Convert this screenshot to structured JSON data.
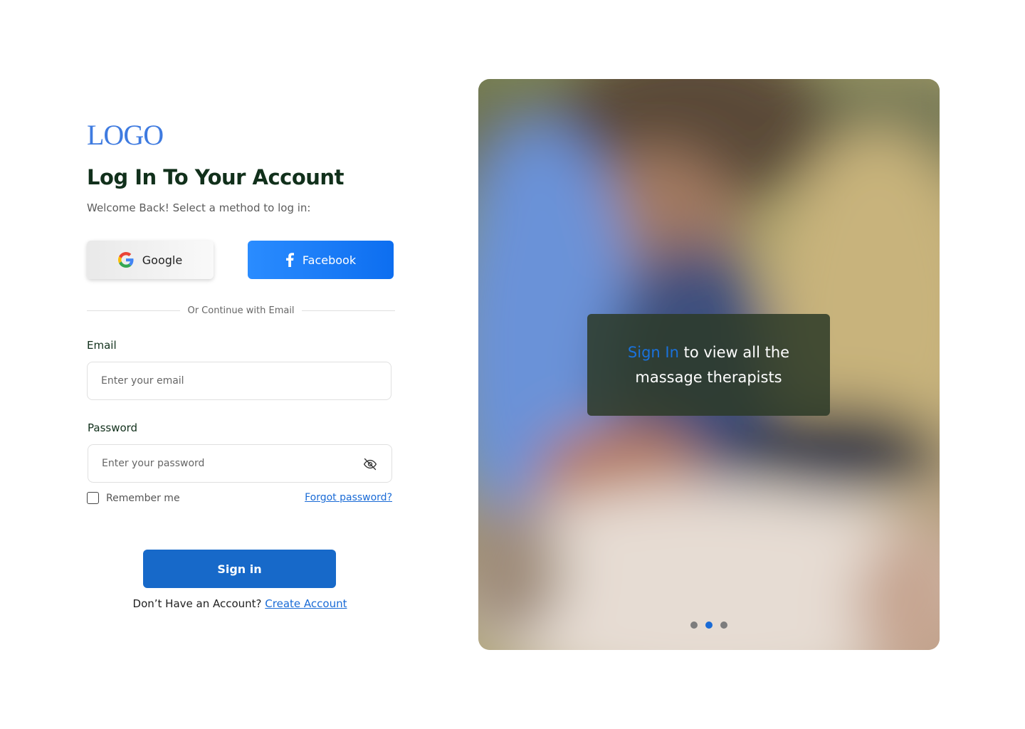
{
  "logo": "LOGO",
  "title": "Log In To Your Account",
  "subtitle": "Welcome Back! Select a method to log in:",
  "social": {
    "google_label": "Google",
    "facebook_label": "Facebook"
  },
  "divider_text": "Or Continue with Email",
  "email": {
    "label": "Email",
    "placeholder": "Enter your email",
    "value": ""
  },
  "password": {
    "label": "Password",
    "placeholder": "Enter your password",
    "value": ""
  },
  "remember_label": "Remember me",
  "remember_checked": false,
  "forgot_label": "Forgot password?",
  "signin_label": "Sign in",
  "signup": {
    "prompt": "Don’t Have an Account?",
    "link": "Create Account"
  },
  "hero": {
    "highlight": "Sign In",
    "text": "to view all the massage therapists",
    "slides": 3,
    "active_slide": 2
  },
  "icons": [
    "google-icon",
    "facebook-icon",
    "eye-off-icon"
  ],
  "colors": {
    "brand_blue": "#1769c9",
    "logo_blue": "#3f7be0",
    "heading_green": "#11301b",
    "facebook_blue": "#1877f2",
    "overlay_bg": "#2c3a28"
  }
}
